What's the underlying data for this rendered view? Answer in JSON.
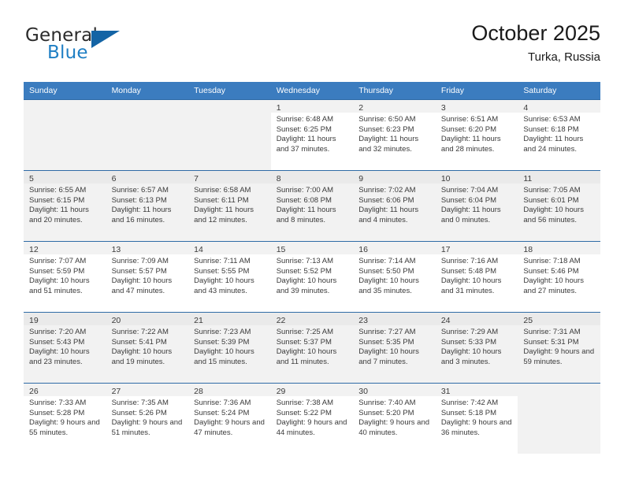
{
  "brand": {
    "word1": "General",
    "word2": "Blue",
    "logo_icon": "triangle-logo-icon",
    "accent_color": "#1464a5",
    "blue_text_color": "#1f7fc4"
  },
  "header": {
    "title": "October 2025",
    "subtitle": "Turka, Russia"
  },
  "calendar": {
    "header_bg": "#3b7cbf",
    "weekday_headers": [
      "Sunday",
      "Monday",
      "Tuesday",
      "Wednesday",
      "Thursday",
      "Friday",
      "Saturday"
    ],
    "labels": {
      "sunrise": "Sunrise:",
      "sunset": "Sunset:",
      "daylight": "Daylight:"
    },
    "weeks": [
      [
        {
          "day": "",
          "lines": []
        },
        {
          "day": "",
          "lines": []
        },
        {
          "day": "",
          "lines": []
        },
        {
          "day": "1",
          "lines": [
            "Sunrise: 6:48 AM",
            "Sunset: 6:25 PM",
            "Daylight: 11 hours and 37 minutes."
          ]
        },
        {
          "day": "2",
          "lines": [
            "Sunrise: 6:50 AM",
            "Sunset: 6:23 PM",
            "Daylight: 11 hours and 32 minutes."
          ]
        },
        {
          "day": "3",
          "lines": [
            "Sunrise: 6:51 AM",
            "Sunset: 6:20 PM",
            "Daylight: 11 hours and 28 minutes."
          ]
        },
        {
          "day": "4",
          "lines": [
            "Sunrise: 6:53 AM",
            "Sunset: 6:18 PM",
            "Daylight: 11 hours and 24 minutes."
          ]
        }
      ],
      [
        {
          "day": "5",
          "lines": [
            "Sunrise: 6:55 AM",
            "Sunset: 6:15 PM",
            "Daylight: 11 hours and 20 minutes."
          ]
        },
        {
          "day": "6",
          "lines": [
            "Sunrise: 6:57 AM",
            "Sunset: 6:13 PM",
            "Daylight: 11 hours and 16 minutes."
          ]
        },
        {
          "day": "7",
          "lines": [
            "Sunrise: 6:58 AM",
            "Sunset: 6:11 PM",
            "Daylight: 11 hours and 12 minutes."
          ]
        },
        {
          "day": "8",
          "lines": [
            "Sunrise: 7:00 AM",
            "Sunset: 6:08 PM",
            "Daylight: 11 hours and 8 minutes."
          ]
        },
        {
          "day": "9",
          "lines": [
            "Sunrise: 7:02 AM",
            "Sunset: 6:06 PM",
            "Daylight: 11 hours and 4 minutes."
          ]
        },
        {
          "day": "10",
          "lines": [
            "Sunrise: 7:04 AM",
            "Sunset: 6:04 PM",
            "Daylight: 11 hours and 0 minutes."
          ]
        },
        {
          "day": "11",
          "lines": [
            "Sunrise: 7:05 AM",
            "Sunset: 6:01 PM",
            "Daylight: 10 hours and 56 minutes."
          ]
        }
      ],
      [
        {
          "day": "12",
          "lines": [
            "Sunrise: 7:07 AM",
            "Sunset: 5:59 PM",
            "Daylight: 10 hours and 51 minutes."
          ]
        },
        {
          "day": "13",
          "lines": [
            "Sunrise: 7:09 AM",
            "Sunset: 5:57 PM",
            "Daylight: 10 hours and 47 minutes."
          ]
        },
        {
          "day": "14",
          "lines": [
            "Sunrise: 7:11 AM",
            "Sunset: 5:55 PM",
            "Daylight: 10 hours and 43 minutes."
          ]
        },
        {
          "day": "15",
          "lines": [
            "Sunrise: 7:13 AM",
            "Sunset: 5:52 PM",
            "Daylight: 10 hours and 39 minutes."
          ]
        },
        {
          "day": "16",
          "lines": [
            "Sunrise: 7:14 AM",
            "Sunset: 5:50 PM",
            "Daylight: 10 hours and 35 minutes."
          ]
        },
        {
          "day": "17",
          "lines": [
            "Sunrise: 7:16 AM",
            "Sunset: 5:48 PM",
            "Daylight: 10 hours and 31 minutes."
          ]
        },
        {
          "day": "18",
          "lines": [
            "Sunrise: 7:18 AM",
            "Sunset: 5:46 PM",
            "Daylight: 10 hours and 27 minutes."
          ]
        }
      ],
      [
        {
          "day": "19",
          "lines": [
            "Sunrise: 7:20 AM",
            "Sunset: 5:43 PM",
            "Daylight: 10 hours and 23 minutes."
          ]
        },
        {
          "day": "20",
          "lines": [
            "Sunrise: 7:22 AM",
            "Sunset: 5:41 PM",
            "Daylight: 10 hours and 19 minutes."
          ]
        },
        {
          "day": "21",
          "lines": [
            "Sunrise: 7:23 AM",
            "Sunset: 5:39 PM",
            "Daylight: 10 hours and 15 minutes."
          ]
        },
        {
          "day": "22",
          "lines": [
            "Sunrise: 7:25 AM",
            "Sunset: 5:37 PM",
            "Daylight: 10 hours and 11 minutes."
          ]
        },
        {
          "day": "23",
          "lines": [
            "Sunrise: 7:27 AM",
            "Sunset: 5:35 PM",
            "Daylight: 10 hours and 7 minutes."
          ]
        },
        {
          "day": "24",
          "lines": [
            "Sunrise: 7:29 AM",
            "Sunset: 5:33 PM",
            "Daylight: 10 hours and 3 minutes."
          ]
        },
        {
          "day": "25",
          "lines": [
            "Sunrise: 7:31 AM",
            "Sunset: 5:31 PM",
            "Daylight: 9 hours and 59 minutes."
          ]
        }
      ],
      [
        {
          "day": "26",
          "lines": [
            "Sunrise: 7:33 AM",
            "Sunset: 5:28 PM",
            "Daylight: 9 hours and 55 minutes."
          ]
        },
        {
          "day": "27",
          "lines": [
            "Sunrise: 7:35 AM",
            "Sunset: 5:26 PM",
            "Daylight: 9 hours and 51 minutes."
          ]
        },
        {
          "day": "28",
          "lines": [
            "Sunrise: 7:36 AM",
            "Sunset: 5:24 PM",
            "Daylight: 9 hours and 47 minutes."
          ]
        },
        {
          "day": "29",
          "lines": [
            "Sunrise: 7:38 AM",
            "Sunset: 5:22 PM",
            "Daylight: 9 hours and 44 minutes."
          ]
        },
        {
          "day": "30",
          "lines": [
            "Sunrise: 7:40 AM",
            "Sunset: 5:20 PM",
            "Daylight: 9 hours and 40 minutes."
          ]
        },
        {
          "day": "31",
          "lines": [
            "Sunrise: 7:42 AM",
            "Sunset: 5:18 PM",
            "Daylight: 9 hours and 36 minutes."
          ]
        },
        {
          "day": "",
          "lines": []
        }
      ]
    ]
  }
}
